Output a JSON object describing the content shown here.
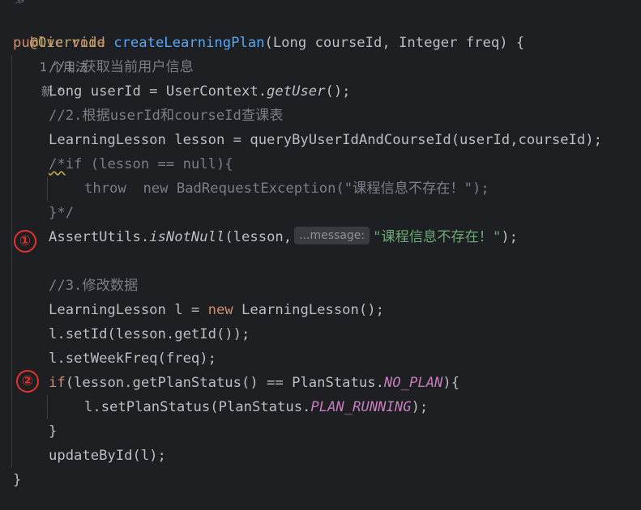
{
  "top_glyph": "≫",
  "annotation": "@Override",
  "usage_hint": "1 个用法",
  "new_hint": "新 *",
  "sig": {
    "public": "public",
    "void": "void",
    "name": "createLearningPlan",
    "params": "(Long courseId, Integer freq) {"
  },
  "comment1": "//1.获取当前用户信息",
  "line_user": {
    "a": "Long userId = UserContext.",
    "b": "getUser",
    "c": "();"
  },
  "comment2": "//2.根据userId和courseId查课表",
  "line_query": "LearningLesson lesson = queryByUserIdAndCourseId(userId,courseId);",
  "block": {
    "open": "/*",
    "if": "if (lesson == null){",
    "throw_kw": "throw",
    "new_kw": "new",
    "throw_rest": " BadRequestException(\"课程信息不存在！\");",
    "close": "}*/"
  },
  "assert": {
    "a": "AssertUtils.",
    "b": "isNotNull",
    "c": "(lesson,",
    "hint": "...message:",
    "str": "\"课程信息不存在！\"",
    "end": ");"
  },
  "comment3": "//3.修改数据",
  "line_new": {
    "a": "LearningLesson l = ",
    "kw": "new",
    "b": " LearningLesson();"
  },
  "line_setid": "l.setId(lesson.getId());",
  "line_setfreq": "l.setWeekFreq(freq);",
  "line_if": {
    "kw": "if",
    "a": "(lesson.getPlanStatus() == PlanStatus.",
    "const": "NO_PLAN",
    "b": "){"
  },
  "line_setstatus": {
    "a": "l.setPlanStatus(PlanStatus.",
    "const": "PLAN_RUNNING",
    "b": ");"
  },
  "close_if": "}",
  "line_update": "updateById(l);",
  "close_method": "}",
  "marker1": "①",
  "marker2": "②"
}
